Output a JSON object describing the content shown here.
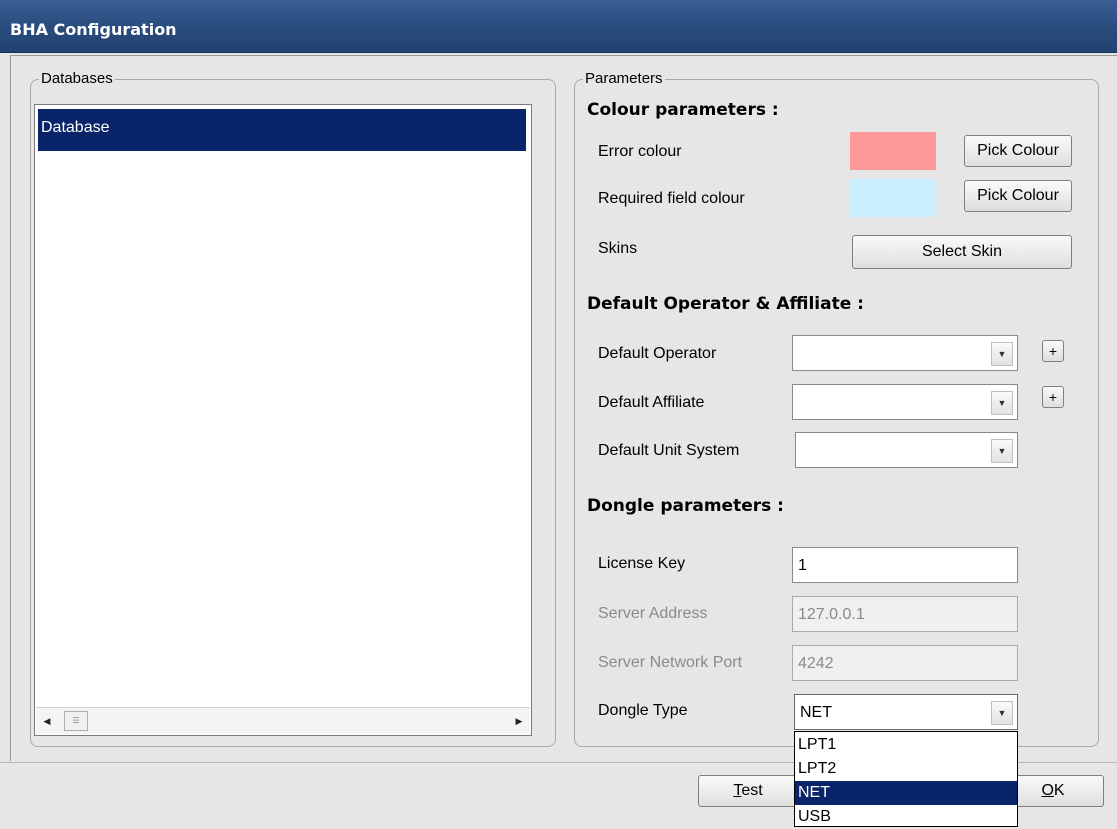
{
  "window": {
    "title": "BHA Configuration"
  },
  "databases": {
    "legend": "Databases",
    "items": [
      "Database"
    ],
    "selected_index": 0
  },
  "parameters": {
    "legend": "Parameters",
    "colour": {
      "heading": "Colour parameters :",
      "error_label": "Error colour",
      "error_color": "#ff9999",
      "required_label": "Required field colour",
      "required_color": "#ccf0ff",
      "pick_label": "Pick Colour",
      "skins_label": "Skins",
      "select_skin_label": "Select Skin"
    },
    "defaults": {
      "heading": "Default Operator & Affiliate :",
      "operator_label": "Default Operator",
      "operator_value": "",
      "affiliate_label": "Default Affiliate",
      "affiliate_value": "",
      "unit_label": "Default Unit System",
      "unit_value": "",
      "add_label": "+"
    },
    "dongle": {
      "heading": "Dongle parameters :",
      "license_label": "License Key",
      "license_value": "1",
      "server_label": "Server Address",
      "server_value": "127.0.0.1",
      "port_label": "Server Network Port",
      "port_value": "4242",
      "type_label": "Dongle Type",
      "type_value": "NET",
      "type_options": [
        "LPT1",
        "LPT2",
        "NET",
        "USB"
      ],
      "type_selected_index": 2
    }
  },
  "footer": {
    "test_label_first": "T",
    "test_label_rest": "est",
    "ok_label_first": "O",
    "ok_label_rest": "K"
  },
  "icons": {
    "scroll_left": "left-arrow-icon",
    "scroll_right": "right-arrow-icon",
    "dropdown": "chevron-down-icon"
  }
}
